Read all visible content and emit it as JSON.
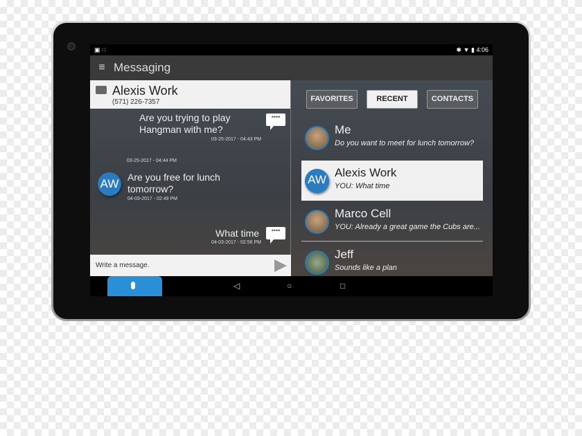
{
  "status": {
    "time": "4:06",
    "left": "▣ ∷",
    "icons": "✱ ▼ ▮"
  },
  "appbar": {
    "title": "Messaging",
    "menu_icon": "≡"
  },
  "conversation": {
    "name": "Alexis Work",
    "phone": "(571) 226-7357",
    "messages": [
      {
        "text": "Are you trying to play Hangman with me?",
        "time": "03-25-2017 - 04:43 PM",
        "from": "me"
      },
      {
        "text": "",
        "time": "03-25-2017 - 04:44 PM",
        "from": "me"
      },
      {
        "text": "Are you free for lunch tomorrow?",
        "time": "04-03-2017 - 02:49 PM",
        "from": "AW"
      },
      {
        "text": "What time",
        "time": "04-03-2017 - 02:56 PM",
        "from": "me"
      }
    ],
    "avatar_initials": "AW",
    "bubble_dots": "••••",
    "input_placeholder": "Write a message."
  },
  "tabs": [
    {
      "label": "FAVORITES"
    },
    {
      "label": "RECENT",
      "selected": true
    },
    {
      "label": "CONTACTS"
    }
  ],
  "contacts": [
    {
      "name": "Me",
      "snippet": "Do you want to meet for lunch tomorrow?"
    },
    {
      "name": "Alexis Work",
      "snippet": "YOU: What time",
      "initials": "AW",
      "selected": true
    },
    {
      "name": "Marco Cell",
      "snippet": "YOU: Already a great game the Cubs are..."
    },
    {
      "name": "Jeff",
      "snippet": "Sounds like a plan"
    }
  ],
  "nav": {
    "back": "◁",
    "home": "○",
    "recents": "□"
  },
  "colors": {
    "accent": "#2a7bc0",
    "mic": "#2a8fd6"
  }
}
